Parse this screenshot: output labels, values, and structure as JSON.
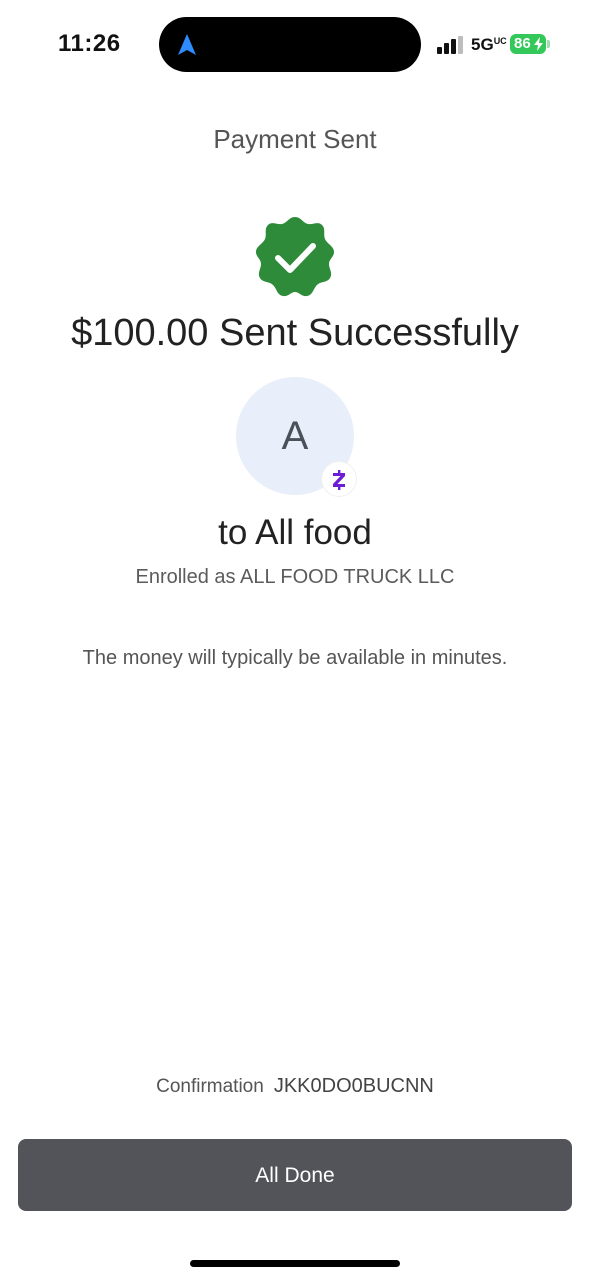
{
  "status_bar": {
    "time": "11:26",
    "network": "5G",
    "network_suffix": "UC",
    "battery": "86",
    "icons": [
      "location-arrow-icon",
      "signal-icon",
      "battery-charging-icon"
    ]
  },
  "header": {
    "title": "Payment Sent"
  },
  "main": {
    "success_icon": "check-badge-icon",
    "headline": "$100.00 Sent Successfully",
    "avatar_initial": "A",
    "avatar_badge": "Z",
    "recipient": "to All food",
    "enrolled": "Enrolled as ALL FOOD TRUCK LLC",
    "note": "The money will typically be available in minutes."
  },
  "footer": {
    "confirmation_label": "Confirmation",
    "confirmation_code": "JKK0DO0BUCNN",
    "done_label": "All Done"
  },
  "colors": {
    "success_green": "#2e8b3a",
    "button_gray": "#525459",
    "avatar_bg": "#e8eefa",
    "zelle_purple": "#6d1ed4",
    "battery_green": "#34c759"
  }
}
